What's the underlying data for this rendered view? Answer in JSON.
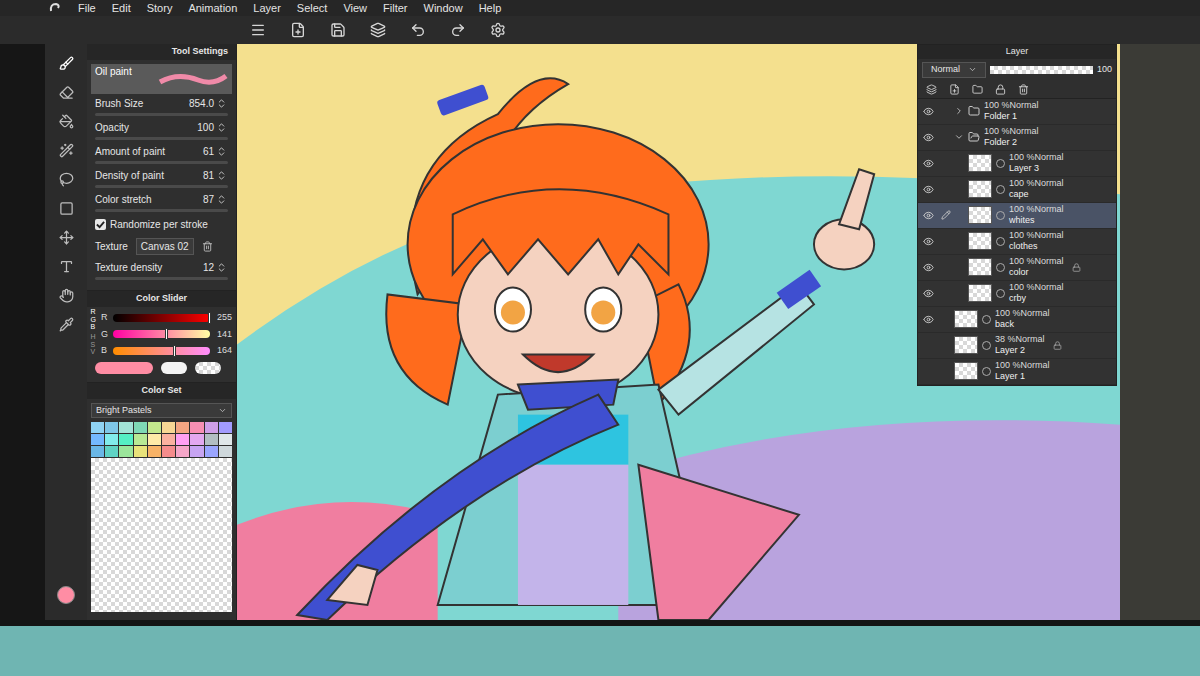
{
  "menu": [
    "File",
    "Edit",
    "Story",
    "Animation",
    "Layer",
    "Select",
    "View",
    "Filter",
    "Window",
    "Help"
  ],
  "tool_settings": {
    "title": "Tool Settings",
    "brush": "Oil paint",
    "rows": [
      {
        "label": "Brush Size",
        "value": "854.0",
        "kind": "number"
      },
      {
        "label": "Opacity",
        "value": "100",
        "kind": "number"
      },
      {
        "label": "Amount of paint",
        "value": "61",
        "kind": "number"
      },
      {
        "label": "Density of paint",
        "value": "81",
        "kind": "number"
      },
      {
        "label": "Color stretch",
        "value": "87",
        "kind": "number"
      },
      {
        "label": "Randomize per stroke",
        "checked": true,
        "kind": "checkbox"
      },
      {
        "label": "Texture",
        "value": "Canvas 02",
        "kind": "select"
      },
      {
        "label": "Texture density",
        "value": "12",
        "kind": "number"
      }
    ]
  },
  "color_slider": {
    "title": "Color Slider",
    "modes": [
      {
        "label": "RGB",
        "selected": true
      },
      {
        "label": "HSV",
        "selected": false
      }
    ],
    "channels": [
      {
        "name": "R",
        "value": "255",
        "level": 1.0
      },
      {
        "name": "G",
        "value": "141",
        "level": 0.553
      },
      {
        "name": "B",
        "value": "164",
        "level": 0.643
      }
    ],
    "main_color": "#ff8da4",
    "sub_color": "#f4f4f4"
  },
  "color_set": {
    "title": "Color Set",
    "set": "Bright Pastels",
    "swatches": [
      "#8fd3f4",
      "#7fc7e8",
      "#a3e4d7",
      "#7ed9b5",
      "#c3e88d",
      "#f7d794",
      "#f3a683",
      "#f78fb3",
      "#cf9fe8",
      "#a29bfe",
      "#74b9ff",
      "#81ecec",
      "#55efc4",
      "#b8e994",
      "#ffeaa7",
      "#fab1a0",
      "#ff9ff3",
      "#e3a8f0",
      "#b2bec3",
      "#dfe6e9",
      "#6ab7e6",
      "#5fd3c4",
      "#9be59b",
      "#e8e27a",
      "#f7b267",
      "#f48c8c",
      "#f4a6c8",
      "#c7a4f2",
      "#9aa5ff",
      "#cfd8dc"
    ]
  },
  "layer_panel": {
    "title": "Layer",
    "blend": "Normal",
    "opacity": "100",
    "layers": [
      {
        "header": "100 %Normal",
        "name": "Folder 1",
        "kind": "folder",
        "expanded": false,
        "indent": false,
        "visible": true,
        "selected": false,
        "locked": false
      },
      {
        "header": "100 %Normal",
        "name": "Folder 2",
        "kind": "folder",
        "expanded": true,
        "indent": false,
        "visible": true,
        "selected": false,
        "locked": false
      },
      {
        "header": "100 %Normal",
        "name": "Layer 3",
        "kind": "raster",
        "expanded": false,
        "indent": true,
        "visible": true,
        "selected": false,
        "locked": false
      },
      {
        "header": "100 %Normal",
        "name": "cape",
        "kind": "raster",
        "expanded": false,
        "indent": true,
        "visible": true,
        "selected": false,
        "locked": false
      },
      {
        "header": "100 %Normal",
        "name": "whites",
        "kind": "raster",
        "expanded": false,
        "indent": true,
        "visible": true,
        "selected": true,
        "locked": false
      },
      {
        "header": "100 %Normal",
        "name": "clothes",
        "kind": "raster",
        "expanded": false,
        "indent": true,
        "visible": true,
        "selected": false,
        "locked": false
      },
      {
        "header": "100 %Normal",
        "name": "color",
        "kind": "raster",
        "expanded": false,
        "indent": true,
        "visible": true,
        "selected": false,
        "locked": true
      },
      {
        "header": "100 %Normal",
        "name": "crby",
        "kind": "raster",
        "expanded": false,
        "indent": true,
        "visible": true,
        "selected": false,
        "locked": false
      },
      {
        "header": "100 %Normal",
        "name": "back",
        "kind": "raster",
        "expanded": false,
        "indent": false,
        "visible": true,
        "selected": false,
        "locked": false
      },
      {
        "header": "38 %Normal",
        "name": "Layer 2",
        "kind": "raster",
        "expanded": false,
        "indent": false,
        "visible": false,
        "selected": false,
        "locked": true
      },
      {
        "header": "100 %Normal",
        "name": "Layer 1",
        "kind": "raster",
        "expanded": false,
        "indent": false,
        "visible": false,
        "selected": false,
        "locked": false
      }
    ]
  }
}
